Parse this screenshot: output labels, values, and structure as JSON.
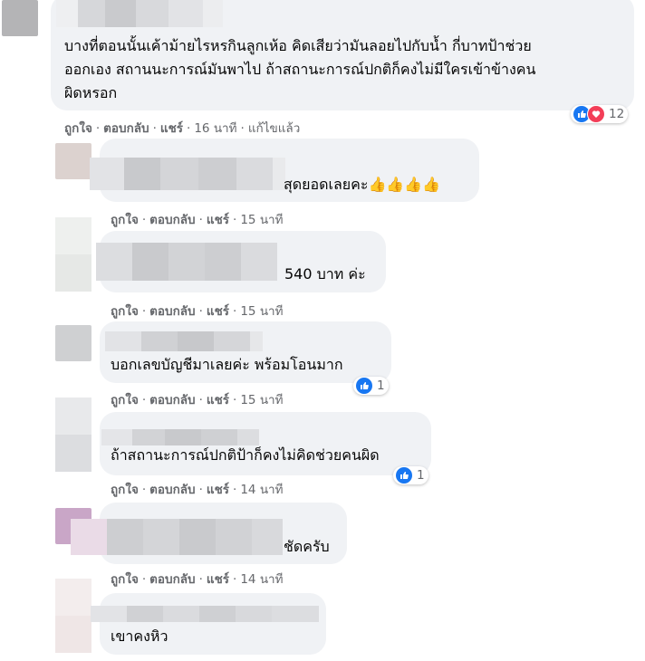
{
  "comments": [
    {
      "text_lines": [
        "บางที่ตอนนั้นเค้าม้ายไรหรกินลูกเห้อ คิดเสียว่ามันลอยไปกับน้ำ กี่บาทป้าช่วย",
        "ออกเอง สถานนะการณ์มันพาไป ถ้าสถานะการณ์ปกติก็คงไม่มีใครเข้าข้างคน",
        "ผิดหรอก"
      ],
      "like": "ถูกใจ",
      "reply": "ตอบกลับ",
      "share": "แชร์",
      "time": "16 นาที",
      "edited": "แก้ไขแล้ว",
      "reactions": {
        "count": "12",
        "types": [
          "like-icon",
          "love-icon"
        ]
      }
    },
    {
      "text": "สุดยอดเลยคะ",
      "emoji": "👍👍👍👍",
      "like": "ถูกใจ",
      "reply": "ตอบกลับ",
      "share": "แชร์",
      "time": "15 นาที"
    },
    {
      "text": "540 บาท ค่ะ",
      "like": "ถูกใจ",
      "reply": "ตอบกลับ",
      "share": "แชร์",
      "time": "15 นาที"
    },
    {
      "text": "บอกเลขบัญชีมาเลยค่ะ พร้อมโอนมาก",
      "like": "ถูกใจ",
      "reply": "ตอบกลับ",
      "share": "แชร์",
      "time": "15 นาที",
      "reactions": {
        "count": "1",
        "types": [
          "like-icon"
        ]
      }
    },
    {
      "text": "ถ้าสถานะการณ์ปกติป้าก็คงไม่คิดช่วยคนผิด",
      "like": "ถูกใจ",
      "reply": "ตอบกลับ",
      "share": "แชร์",
      "time": "14 นาที",
      "reactions": {
        "count": "1",
        "types": [
          "like-icon"
        ]
      }
    },
    {
      "text": "ชัดครับ",
      "like": "ถูกใจ",
      "reply": "ตอบกลับ",
      "share": "แชร์",
      "time": "14 นาที"
    },
    {
      "text": "เขาคงหิว"
    }
  ],
  "colors": {
    "bubble": "#f0f2f5",
    "meta": "#65676b",
    "like": "#1877f2",
    "love": "#f33e58",
    "text": "#050505"
  }
}
